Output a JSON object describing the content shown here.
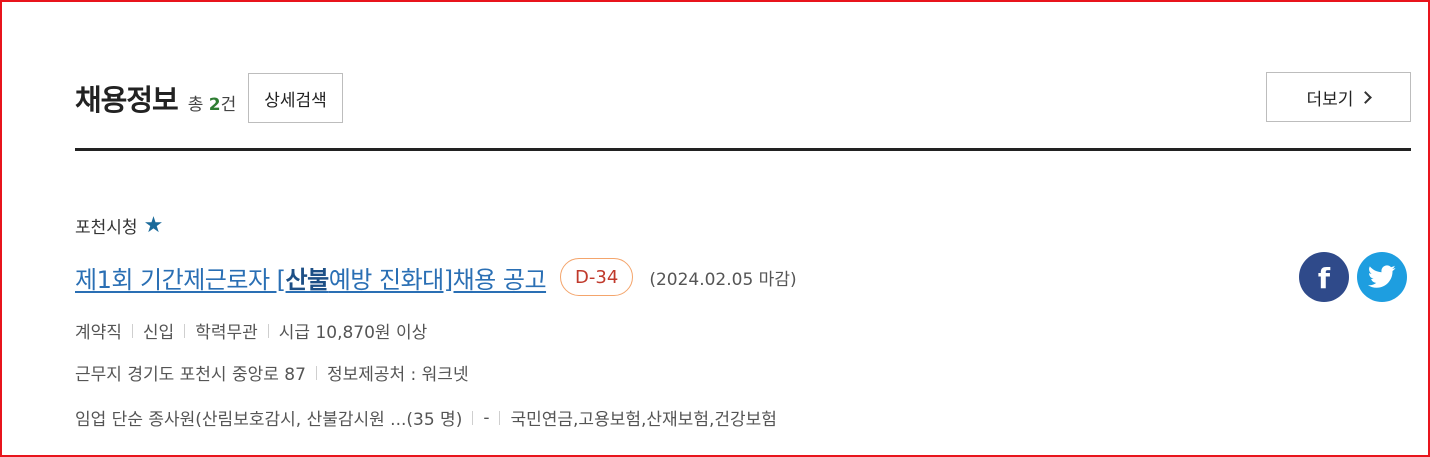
{
  "header": {
    "title": "채용정보",
    "count_prefix": "총",
    "count": "2",
    "count_suffix": "건",
    "detail_search_label": "상세검색",
    "more_label": "더보기"
  },
  "job": {
    "organization": "포천시청",
    "title_before": "제1회 기간제근로자 [",
    "title_highlight": "산불",
    "title_after": "예방 진화대]채용 공고",
    "dday": "D-34",
    "deadline": "(2024.02.05 마감)",
    "row1": [
      "계약직",
      "신입",
      "학력무관",
      "시급 10,870원 이상"
    ],
    "row2": [
      "근무지 경기도 포천시 중앙로 87",
      "정보제공처 : 워크넷"
    ],
    "row3": [
      "임업 단순 종사원(산림보호감시, 산불감시원 ...(35 명)",
      "-",
      "국민연금,고용보험,산재보험,건강보험"
    ]
  },
  "colors": {
    "accent_link": "#2a6fb4",
    "count_green": "#2e7d32",
    "dday_border": "#f4a56c",
    "facebook": "#2f4a8a",
    "twitter": "#1e9ee0",
    "frame": "#e8141c"
  },
  "icons": {
    "favorite": "star-icon",
    "share_facebook": "facebook-icon",
    "share_twitter": "twitter-icon",
    "more": "chevron-right-icon"
  }
}
